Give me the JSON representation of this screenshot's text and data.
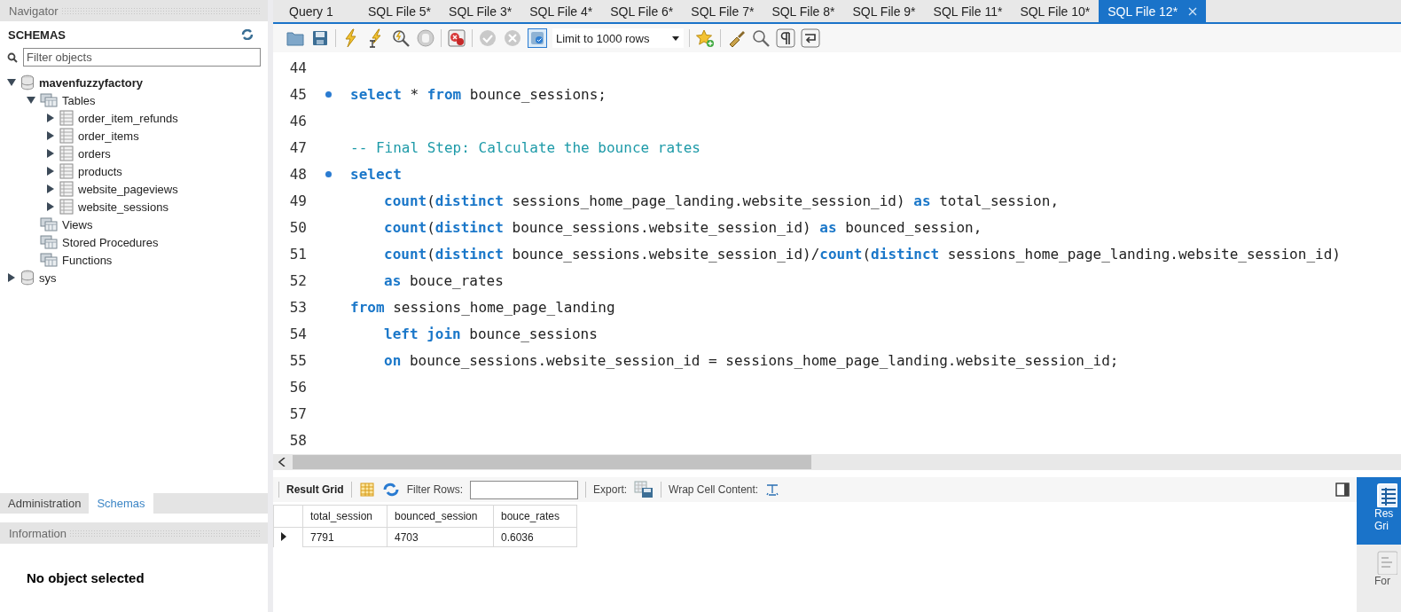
{
  "navigator": {
    "title": "Navigator",
    "schemas_label": "SCHEMAS",
    "filter": {
      "placeholder": "Filter objects"
    },
    "tree": [
      {
        "label": "mavenfuzzyfactory",
        "kind": "schema",
        "expanded": true,
        "default": true,
        "children": [
          {
            "label": "Tables",
            "kind": "folder",
            "expanded": true,
            "children": [
              {
                "label": "order_item_refunds",
                "kind": "table",
                "expanded": false
              },
              {
                "label": "order_items",
                "kind": "table",
                "expanded": false
              },
              {
                "label": "orders",
                "kind": "table",
                "expanded": false
              },
              {
                "label": "products",
                "kind": "table",
                "expanded": false
              },
              {
                "label": "website_pageviews",
                "kind": "table",
                "expanded": false
              },
              {
                "label": "website_sessions",
                "kind": "table",
                "expanded": false
              }
            ]
          },
          {
            "label": "Views",
            "kind": "folder"
          },
          {
            "label": "Stored Procedures",
            "kind": "folder"
          },
          {
            "label": "Functions",
            "kind": "folder"
          }
        ]
      },
      {
        "label": "sys",
        "kind": "schema",
        "expanded": false,
        "default": false
      }
    ],
    "bottom_tabs": [
      {
        "label": "Administration",
        "selected": false
      },
      {
        "label": "Schemas",
        "selected": true
      }
    ],
    "information": {
      "title": "Information",
      "message": "No object selected"
    }
  },
  "editor_tabs": [
    {
      "label": "Query 1",
      "selected": false
    },
    {
      "label": "SQL File 5*",
      "selected": false
    },
    {
      "label": "SQL File 3*",
      "selected": false
    },
    {
      "label": "SQL File 4*",
      "selected": false
    },
    {
      "label": "SQL File 6*",
      "selected": false
    },
    {
      "label": "SQL File 7*",
      "selected": false
    },
    {
      "label": "SQL File 8*",
      "selected": false
    },
    {
      "label": "SQL File 9*",
      "selected": false
    },
    {
      "label": "SQL File 11*",
      "selected": false
    },
    {
      "label": "SQL File 10*",
      "selected": false
    },
    {
      "label": "SQL File 12*",
      "selected": true
    }
  ],
  "toolbar": {
    "toggle_on": true,
    "limit": "Limit to 1000 rows"
  },
  "code_lines": [
    {
      "number": "44",
      "marker": false
    },
    {
      "number": "45",
      "marker": true,
      "tokens": [
        {
          "kind": "keyword",
          "text": "select"
        },
        {
          "kind": "plain",
          "text": " * "
        },
        {
          "kind": "keyword",
          "text": "from"
        },
        {
          "kind": "plain",
          "text": " bounce_sessions;"
        }
      ]
    },
    {
      "number": "46",
      "marker": false
    },
    {
      "number": "47",
      "marker": false,
      "tokens": [
        {
          "kind": "comment",
          "text": "-- Final Step: Calculate the bounce rates"
        }
      ]
    },
    {
      "number": "48",
      "marker": true,
      "tokens": [
        {
          "kind": "keyword",
          "text": "select"
        }
      ]
    },
    {
      "number": "49",
      "marker": false,
      "indented": true,
      "tokens": [
        {
          "kind": "keyword",
          "text": "count"
        },
        {
          "kind": "plain",
          "text": "("
        },
        {
          "kind": "keyword",
          "text": "distinct"
        },
        {
          "kind": "plain",
          "text": " sessions_home_page_landing.website_session_id) "
        },
        {
          "kind": "keyword",
          "text": "as"
        },
        {
          "kind": "plain",
          "text": " total_session,"
        }
      ]
    },
    {
      "number": "50",
      "marker": false,
      "indented": true,
      "tokens": [
        {
          "kind": "keyword",
          "text": "count"
        },
        {
          "kind": "plain",
          "text": "("
        },
        {
          "kind": "keyword",
          "text": "distinct"
        },
        {
          "kind": "plain",
          "text": " bounce_sessions.website_session_id) "
        },
        {
          "kind": "keyword",
          "text": "as"
        },
        {
          "kind": "plain",
          "text": " bounced_session,"
        }
      ]
    },
    {
      "number": "51",
      "marker": false,
      "indented": true,
      "tokens": [
        {
          "kind": "keyword",
          "text": "count"
        },
        {
          "kind": "plain",
          "text": "("
        },
        {
          "kind": "keyword",
          "text": "distinct"
        },
        {
          "kind": "plain",
          "text": " bounce_sessions.website_session_id)/"
        },
        {
          "kind": "keyword",
          "text": "count"
        },
        {
          "kind": "plain",
          "text": "("
        },
        {
          "kind": "keyword",
          "text": "distinct"
        },
        {
          "kind": "plain",
          "text": " sessions_home_page_landing.website_session_id)"
        }
      ]
    },
    {
      "number": "52",
      "marker": false,
      "indented": true,
      "tokens": [
        {
          "kind": "keyword",
          "text": "as"
        },
        {
          "kind": "plain",
          "text": " bouce_rates"
        }
      ]
    },
    {
      "number": "53",
      "marker": false,
      "tokens": [
        {
          "kind": "keyword",
          "text": "from"
        },
        {
          "kind": "plain",
          "text": " sessions_home_page_landing"
        }
      ]
    },
    {
      "number": "54",
      "marker": false,
      "indented": true,
      "tokens": [
        {
          "kind": "keyword",
          "text": "left join"
        },
        {
          "kind": "plain",
          "text": " bounce_sessions"
        }
      ]
    },
    {
      "number": "55",
      "marker": false,
      "indented": true,
      "tokens": [
        {
          "kind": "keyword",
          "text": "on"
        },
        {
          "kind": "plain",
          "text": " bounce_sessions.website_session_id = sessions_home_page_landing.website_session_id;"
        }
      ]
    },
    {
      "number": "56",
      "marker": false
    },
    {
      "number": "57",
      "marker": false
    },
    {
      "number": "58",
      "marker": false
    }
  ],
  "result_toolbar": {
    "result_grid": "Result Grid",
    "filter_label": "Filter Rows:",
    "export_label": "Export:",
    "wrap_label": "Wrap Cell Content:"
  },
  "result_table": {
    "columns": [
      "total_session",
      "bounced_session",
      "bouce_rates"
    ],
    "rows": [
      {
        "selected": true,
        "cells": [
          "7791",
          "4703",
          "0.6036"
        ]
      }
    ]
  },
  "side_tabs": [
    {
      "lines": [
        "Res",
        "Gri"
      ],
      "selected": true
    },
    {
      "lines": [
        "For"
      ],
      "selected": false
    }
  ]
}
